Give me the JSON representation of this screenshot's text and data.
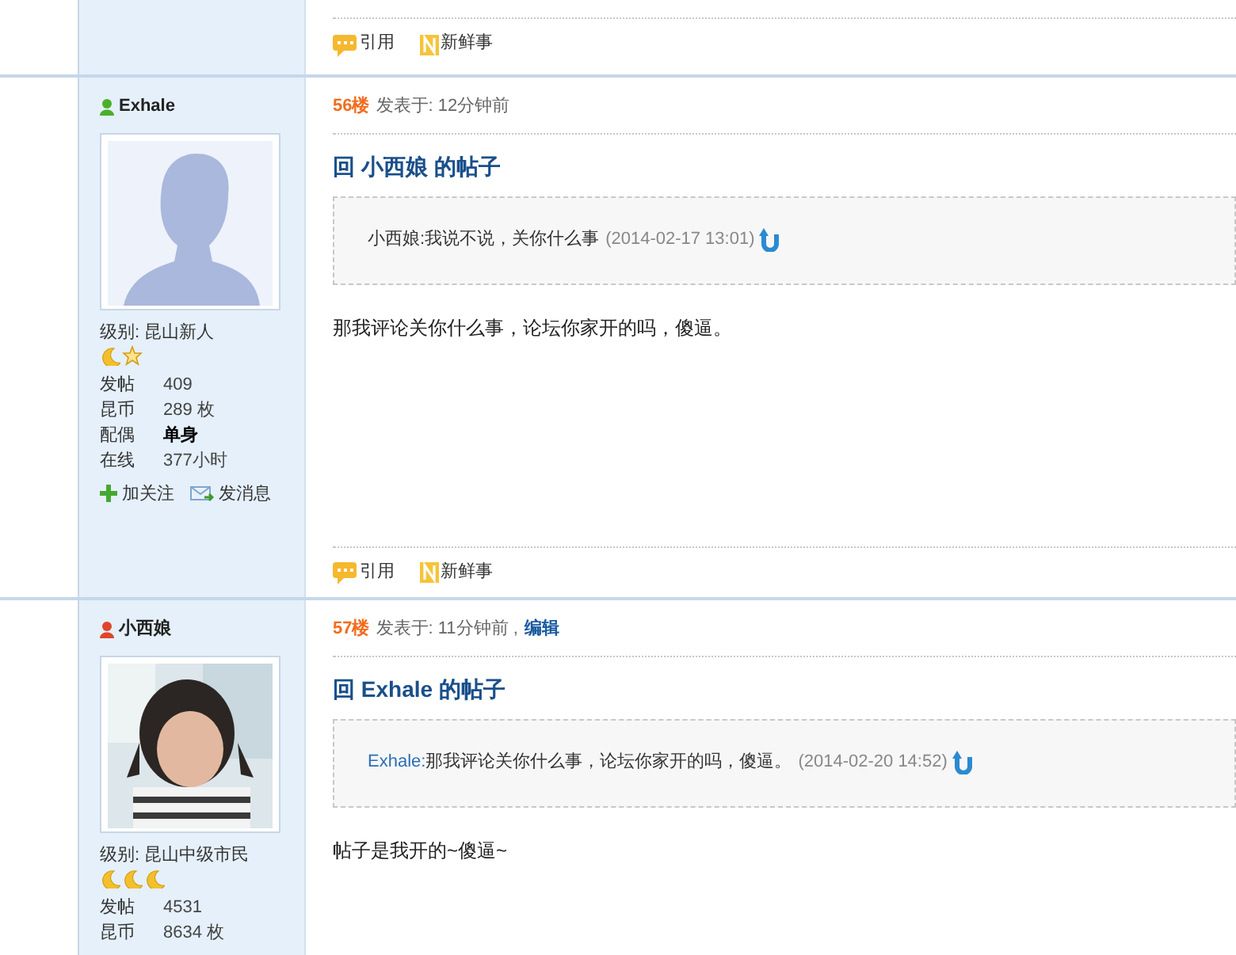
{
  "top_footer": {
    "actions": [
      {
        "kind": "quote",
        "label": "引用"
      },
      {
        "kind": "news",
        "label": "新鲜事"
      }
    ]
  },
  "posts": [
    {
      "author": "Exhale",
      "color": "#4caf2a",
      "rank": "级别: 昆山新人",
      "rank_icons": [
        {
          "kind": "moon"
        },
        {
          "kind": "star"
        }
      ],
      "stats": [
        {
          "label": "发帖",
          "value": "409",
          "strong": false
        },
        {
          "label": "昆币",
          "value": "289 枚",
          "strong": false
        },
        {
          "label": "配偶",
          "value": "单身",
          "strong": true
        },
        {
          "label": "在线",
          "value": "377小时",
          "strong": false
        }
      ],
      "user_actions": [
        {
          "kind": "follow",
          "label": "加关注"
        },
        {
          "kind": "message",
          "label": "发消息"
        }
      ],
      "floor": "56楼",
      "posted": "发表于: 12分钟前",
      "title": "回 小西娘 的帖子",
      "quote": {
        "author": "小西娘:",
        "author_link": false,
        "text": "我说不说，关你什么事",
        "time": "(2014-02-17 13:01)"
      },
      "body": "那我评论关你什么事，论坛你家开的吗，傻逼。",
      "actions": [
        {
          "kind": "quote",
          "label": "引用"
        },
        {
          "kind": "news",
          "label": "新鲜事"
        }
      ]
    },
    {
      "author": "小西娘",
      "color": "#e0452b",
      "rank": "级别: 昆山中级市民",
      "rank_icons": [
        {
          "kind": "moon"
        },
        {
          "kind": "moon"
        },
        {
          "kind": "moon"
        }
      ],
      "stats": [
        {
          "label": "发帖",
          "value": "4531",
          "strong": false
        },
        {
          "label": "昆币",
          "value": "8634 枚",
          "strong": false
        }
      ],
      "floor": "57楼",
      "posted": "发表于: 11分钟前 ,",
      "edit": "编辑",
      "title": "回 Exhale 的帖子",
      "quote": {
        "author": "Exhale:",
        "author_link": true,
        "text": "那我评论关你什么事，论坛你家开的吗，傻逼。",
        "time": "(2014-02-20 14:52)"
      },
      "body": "帖子是我开的~傻逼~"
    }
  ]
}
